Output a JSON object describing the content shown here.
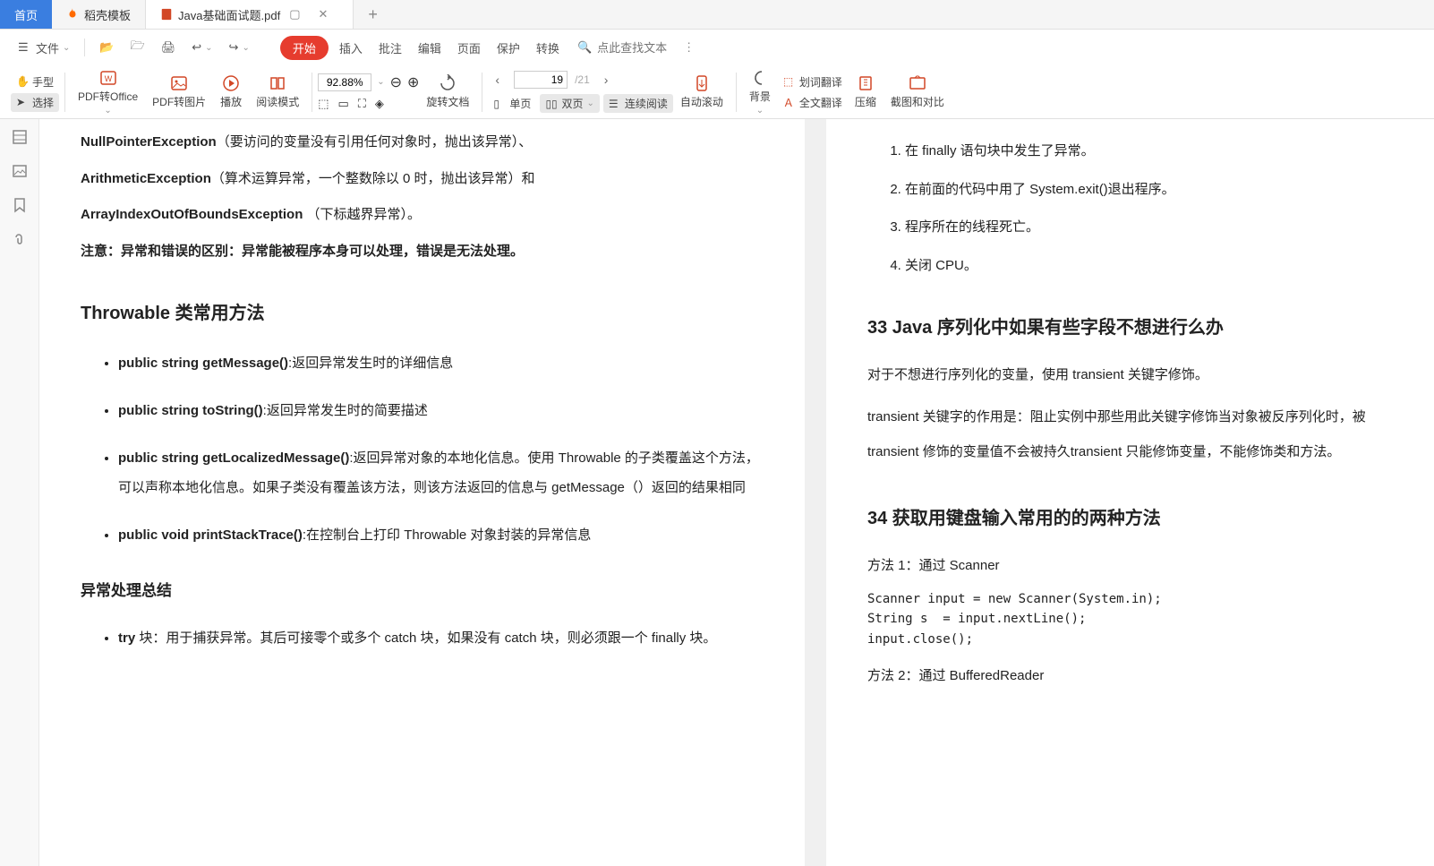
{
  "tabs": {
    "home": "首页",
    "docke": "稻壳模板",
    "active": "Java基础面试题.pdf"
  },
  "toolbar": {
    "file": "文件",
    "start": "开始",
    "insert": "插入",
    "comment": "批注",
    "edit": "编辑",
    "page": "页面",
    "protect": "保护",
    "convert": "转换",
    "search_placeholder": "点此查找文本"
  },
  "ribbon": {
    "hand": "手型",
    "select": "选择",
    "pdf_office": "PDF转Office",
    "pdf_img": "PDF转图片",
    "play": "播放",
    "read_mode": "阅读模式",
    "zoom": "92.88%",
    "rotate": "旋转文档",
    "single": "单页",
    "double": "双页",
    "continuous": "连续阅读",
    "page_current": "19",
    "page_total": "/21",
    "auto_scroll": "自动滚动",
    "bg": "背景",
    "word_trans": "划词翻译",
    "full_trans": "全文翻译",
    "compress": "压缩",
    "screenshot": "截图和对比"
  },
  "doc_left": {
    "line1_b": "NullPointerException",
    "line1_t": "（要访问的变量没有引用任何对象时，抛出该异常）、",
    "line2_b": "ArithmeticException",
    "line2_t": "（算术运算异常，一个整数除以 0 时，抛出该异常）和",
    "line3_b": " ArrayIndexOutOfBoundsException ",
    "line3_t": "（下标越界异常）。",
    "note": "注意：异常和错误的区别：异常能被程序本身可以处理，错误是无法处理。",
    "h3": "Throwable 类常用方法",
    "m1_b": "public string getMessage()",
    "m1_t": ":返回异常发生时的详细信息",
    "m2_b": "public string toString()",
    "m2_t": ":返回异常发生时的简要描述",
    "m3_b": "public string getLocalizedMessage()",
    "m3_t": ":返回异常对象的本地化信息。使用 Throwable 的子类覆盖这个方法，可以声称本地化信息。如果子类没有覆盖该方法，则该方法返回的信息与 getMessage（）返回的结果相同",
    "m4_b": "public void printStackTrace()",
    "m4_t": ":在控制台上打印 Throwable 对象封装的异常信息",
    "h4": "异常处理总结",
    "try_b": "try",
    "try_t": " 块：用于捕获异常。其后可接零个或多个 catch 块，如果没有 catch 块，则必须跟一个 finally 块。"
  },
  "doc_right": {
    "ol1": "在 finally 语句块中发生了异常。",
    "ol2": "在前面的代码中用了 System.exit()退出程序。",
    "ol3": "程序所在的线程死亡。",
    "ol4": "关闭 CPU。",
    "h33": "33 Java 序列化中如果有些字段不想进行么办",
    "p33a": "对于不想进行序列化的变量，使用 transient 关键字修饰。",
    "p33b": "transient 关键字的作用是：阻止实例中那些用此关键字修饰当对象被反序列化时，被 transient 修饰的变量值不会被持久transient 只能修饰变量，不能修饰类和方法。",
    "h34": "34  获取用键盘输入常用的的两种方法",
    "p34a": "方法 1：通过 Scanner",
    "code1": "Scanner input = new Scanner(System.in);",
    "code2": "String s  = input.nextLine();",
    "code3": "input.close();",
    "p34b": "方法 2：通过 BufferedReader"
  }
}
